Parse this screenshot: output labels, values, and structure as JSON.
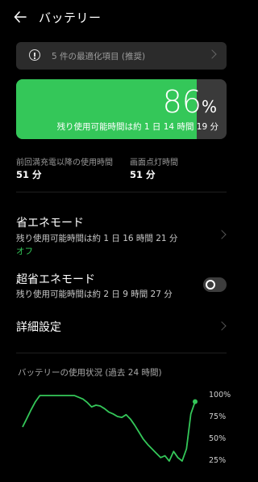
{
  "header": {
    "title": "バッテリー",
    "back_icon": "back-arrow-icon"
  },
  "optimization": {
    "text": "5 件の最適化項目 (推奨)"
  },
  "battery": {
    "level_value": "86",
    "level_unit": "%",
    "level_fraction": 0.86,
    "remaining": "残り使用可能時間は約 1 日 14 時間 19 分",
    "color": "#34c759"
  },
  "stats": [
    {
      "label": "前回満充電以降の使用時間",
      "value": "51 分"
    },
    {
      "label": "画面点灯時間",
      "value": "51 分"
    }
  ],
  "power_saving": {
    "title": "省エネモード",
    "subtitle": "残り使用可能時間は約 1 日 16 時間 21 分",
    "status": "オフ"
  },
  "ultra_power_saving": {
    "title": "超省エネモード",
    "subtitle": "残り使用可能時間は約 2 日 9 時間 27 分",
    "toggle": "off"
  },
  "details": {
    "title": "詳細設定"
  },
  "usage": {
    "title": "バッテリーの使用状況 (過去 24 時間)"
  },
  "chart_data": {
    "type": "line",
    "yticks": [
      "100%",
      "75%",
      "50%",
      "25%"
    ],
    "ylim": [
      0,
      100
    ],
    "x": [
      0,
      1,
      2,
      3,
      4,
      5,
      6,
      7,
      8,
      9,
      10,
      11,
      12,
      13,
      14,
      15,
      16,
      17,
      18,
      19,
      20,
      21,
      22,
      23,
      24,
      25,
      26,
      27,
      28,
      29,
      30,
      31,
      32,
      33,
      34,
      35,
      36,
      37,
      38,
      39,
      40
    ],
    "values": [
      63,
      73,
      83,
      92,
      99,
      99,
      99,
      99,
      99,
      99,
      99,
      99,
      99,
      97,
      95,
      91,
      86,
      88,
      87,
      84,
      80,
      78,
      75,
      74,
      77,
      72,
      65,
      57,
      49,
      43,
      38,
      33,
      28,
      30,
      24,
      35,
      28,
      24,
      38,
      78,
      92
    ],
    "color": "#34c759",
    "grid": false
  }
}
